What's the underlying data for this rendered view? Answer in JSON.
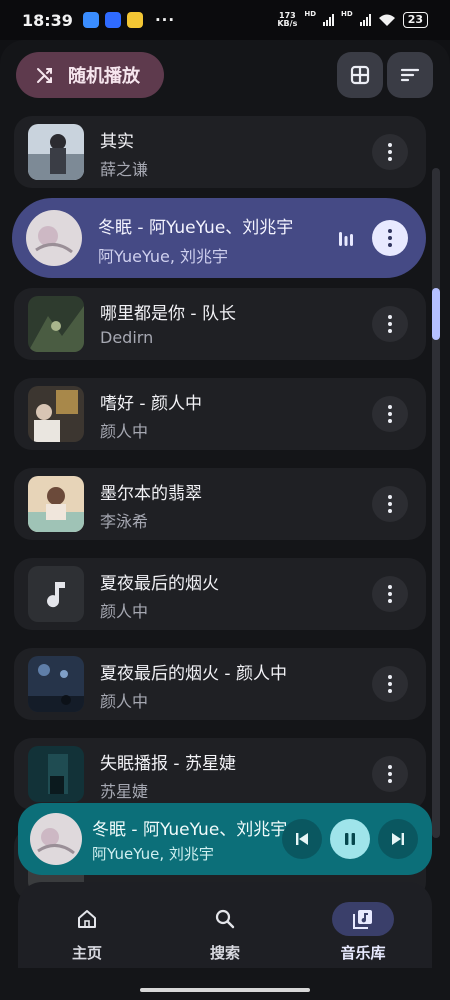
{
  "status_bar": {
    "time": "18:39",
    "more": "···",
    "net_speed_value": "173",
    "net_speed_unit": "KB/s",
    "hd1": "HD",
    "hd2": "HD",
    "battery": "23"
  },
  "toolbar": {
    "shuffle_label": "随机播放",
    "grid_icon": "grid-view-icon",
    "sort_icon": "sort-icon"
  },
  "songs": [
    {
      "title": "其实",
      "artist": "薛之谦",
      "active": false
    },
    {
      "title": "冬眠 - 阿YueYue、刘兆宇",
      "artist": "阿YueYue, 刘兆宇",
      "active": true
    },
    {
      "title": "哪里都是你 - 队长",
      "artist": "Dedirn",
      "active": false
    },
    {
      "title": "嗜好 - 颜人中",
      "artist": "颜人中",
      "active": false
    },
    {
      "title": "墨尔本的翡翠",
      "artist": "李泳希",
      "active": false
    },
    {
      "title": "夏夜最后的烟火",
      "artist": "颜人中",
      "active": false
    },
    {
      "title": "夏夜最后的烟火 - 颜人中",
      "artist": "颜人中",
      "active": false
    },
    {
      "title": "失眠播报 - 苏星婕",
      "artist": "苏星婕",
      "active": false
    }
  ],
  "mini_player": {
    "title": "冬眠 - 阿YueYue、刘兆宇",
    "artist": "阿YueYue, 刘兆宇"
  },
  "nav": {
    "home": "主页",
    "search": "搜索",
    "library": "音乐库"
  },
  "colors": {
    "accent_active_row": "#454a85",
    "shuffle_bg": "#5e3a4d",
    "mini_player_bg": "#0c6f79"
  }
}
